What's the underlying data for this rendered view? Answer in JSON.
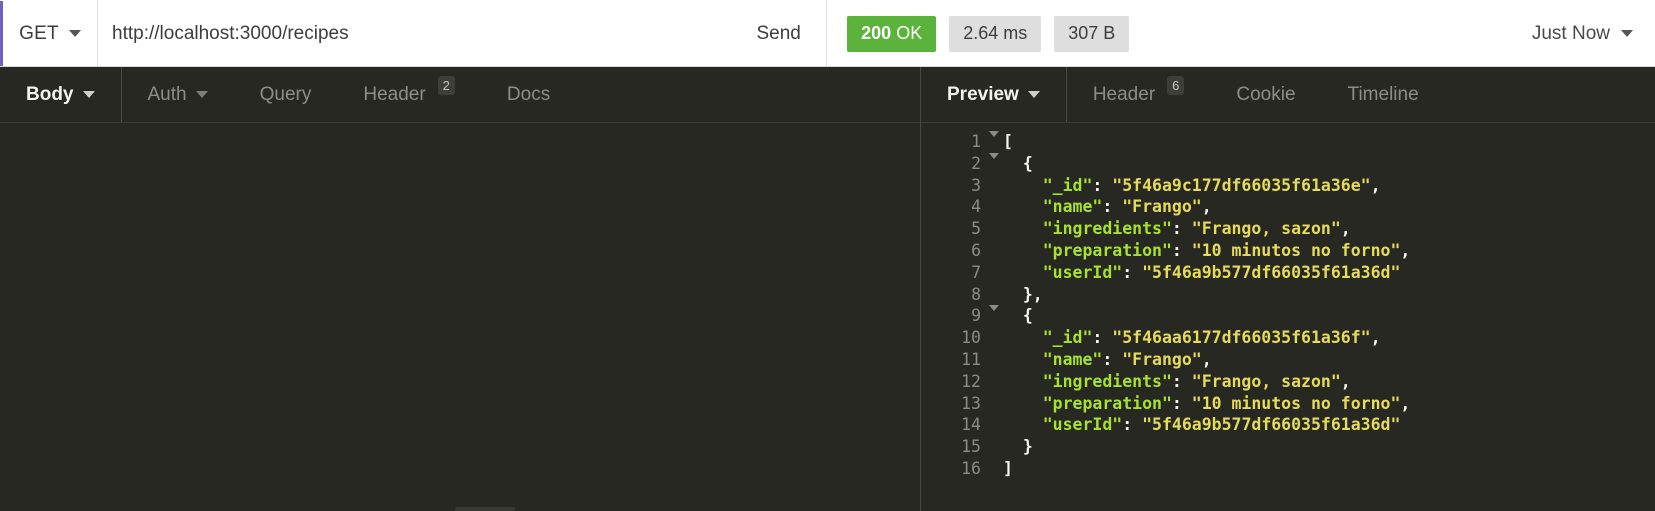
{
  "request": {
    "method": "GET",
    "method_caret_icon": "chevron-down-icon",
    "url": "http://localhost:3000/recipes",
    "send_label": "Send"
  },
  "status": {
    "code": "200",
    "text": "OK",
    "time": "2.64 ms",
    "size": "307 B",
    "accent_green": "#5cb33c",
    "pill_grey": "#dedede"
  },
  "history": {
    "label": "Just Now",
    "caret_icon": "chevron-down-icon"
  },
  "request_tabs": [
    {
      "label": "Body",
      "badge": "",
      "caret": true,
      "active": true
    },
    {
      "label": "Auth",
      "badge": "",
      "caret": true,
      "active": false
    },
    {
      "label": "Query",
      "badge": "",
      "caret": false,
      "active": false
    },
    {
      "label": "Header",
      "badge": "2",
      "caret": false,
      "active": false
    },
    {
      "label": "Docs",
      "badge": "",
      "caret": false,
      "active": false
    }
  ],
  "response_tabs": [
    {
      "label": "Preview",
      "badge": "",
      "caret": true,
      "active": true
    },
    {
      "label": "Header",
      "badge": "6",
      "caret": false,
      "active": false
    },
    {
      "label": "Cookie",
      "badge": "",
      "caret": false,
      "active": false
    },
    {
      "label": "Timeline",
      "badge": "",
      "caret": false,
      "active": false
    }
  ],
  "response_body": {
    "language": "json",
    "theme_bg": "#272822",
    "key_color": "#a6e22e",
    "string_color": "#e6db5a",
    "lines": [
      {
        "n": "1",
        "fold": true,
        "indent": 0,
        "tokens": [
          {
            "t": "p",
            "v": "["
          }
        ]
      },
      {
        "n": "2",
        "fold": true,
        "indent": 1,
        "tokens": [
          {
            "t": "p",
            "v": "{"
          }
        ]
      },
      {
        "n": "3",
        "fold": false,
        "indent": 2,
        "tokens": [
          {
            "t": "k",
            "v": "\"_id\""
          },
          {
            "t": "p",
            "v": ": "
          },
          {
            "t": "s",
            "v": "\"5f46a9c177df66035f61a36e\""
          },
          {
            "t": "p",
            "v": ","
          }
        ]
      },
      {
        "n": "4",
        "fold": false,
        "indent": 2,
        "tokens": [
          {
            "t": "k",
            "v": "\"name\""
          },
          {
            "t": "p",
            "v": ": "
          },
          {
            "t": "s",
            "v": "\"Frango\""
          },
          {
            "t": "p",
            "v": ","
          }
        ]
      },
      {
        "n": "5",
        "fold": false,
        "indent": 2,
        "tokens": [
          {
            "t": "k",
            "v": "\"ingredients\""
          },
          {
            "t": "p",
            "v": ": "
          },
          {
            "t": "s",
            "v": "\"Frango, sazon\""
          },
          {
            "t": "p",
            "v": ","
          }
        ]
      },
      {
        "n": "6",
        "fold": false,
        "indent": 2,
        "tokens": [
          {
            "t": "k",
            "v": "\"preparation\""
          },
          {
            "t": "p",
            "v": ": "
          },
          {
            "t": "s",
            "v": "\"10 minutos no forno\""
          },
          {
            "t": "p",
            "v": ","
          }
        ]
      },
      {
        "n": "7",
        "fold": false,
        "indent": 2,
        "tokens": [
          {
            "t": "k",
            "v": "\"userId\""
          },
          {
            "t": "p",
            "v": ": "
          },
          {
            "t": "s",
            "v": "\"5f46a9b577df66035f61a36d\""
          }
        ]
      },
      {
        "n": "8",
        "fold": false,
        "indent": 1,
        "tokens": [
          {
            "t": "p",
            "v": "},"
          }
        ]
      },
      {
        "n": "9",
        "fold": true,
        "indent": 1,
        "tokens": [
          {
            "t": "p",
            "v": "{"
          }
        ]
      },
      {
        "n": "10",
        "fold": false,
        "indent": 2,
        "tokens": [
          {
            "t": "k",
            "v": "\"_id\""
          },
          {
            "t": "p",
            "v": ": "
          },
          {
            "t": "s",
            "v": "\"5f46aa6177df66035f61a36f\""
          },
          {
            "t": "p",
            "v": ","
          }
        ]
      },
      {
        "n": "11",
        "fold": false,
        "indent": 2,
        "tokens": [
          {
            "t": "k",
            "v": "\"name\""
          },
          {
            "t": "p",
            "v": ": "
          },
          {
            "t": "s",
            "v": "\"Frango\""
          },
          {
            "t": "p",
            "v": ","
          }
        ]
      },
      {
        "n": "12",
        "fold": false,
        "indent": 2,
        "tokens": [
          {
            "t": "k",
            "v": "\"ingredients\""
          },
          {
            "t": "p",
            "v": ": "
          },
          {
            "t": "s",
            "v": "\"Frango, sazon\""
          },
          {
            "t": "p",
            "v": ","
          }
        ]
      },
      {
        "n": "13",
        "fold": false,
        "indent": 2,
        "tokens": [
          {
            "t": "k",
            "v": "\"preparation\""
          },
          {
            "t": "p",
            "v": ": "
          },
          {
            "t": "s",
            "v": "\"10 minutos no forno\""
          },
          {
            "t": "p",
            "v": ","
          }
        ]
      },
      {
        "n": "14",
        "fold": false,
        "indent": 2,
        "tokens": [
          {
            "t": "k",
            "v": "\"userId\""
          },
          {
            "t": "p",
            "v": ": "
          },
          {
            "t": "s",
            "v": "\"5f46a9b577df66035f61a36d\""
          }
        ]
      },
      {
        "n": "15",
        "fold": false,
        "indent": 1,
        "tokens": [
          {
            "t": "p",
            "v": "}"
          }
        ]
      },
      {
        "n": "16",
        "fold": false,
        "indent": 0,
        "tokens": [
          {
            "t": "p",
            "v": "]"
          }
        ]
      }
    ]
  }
}
